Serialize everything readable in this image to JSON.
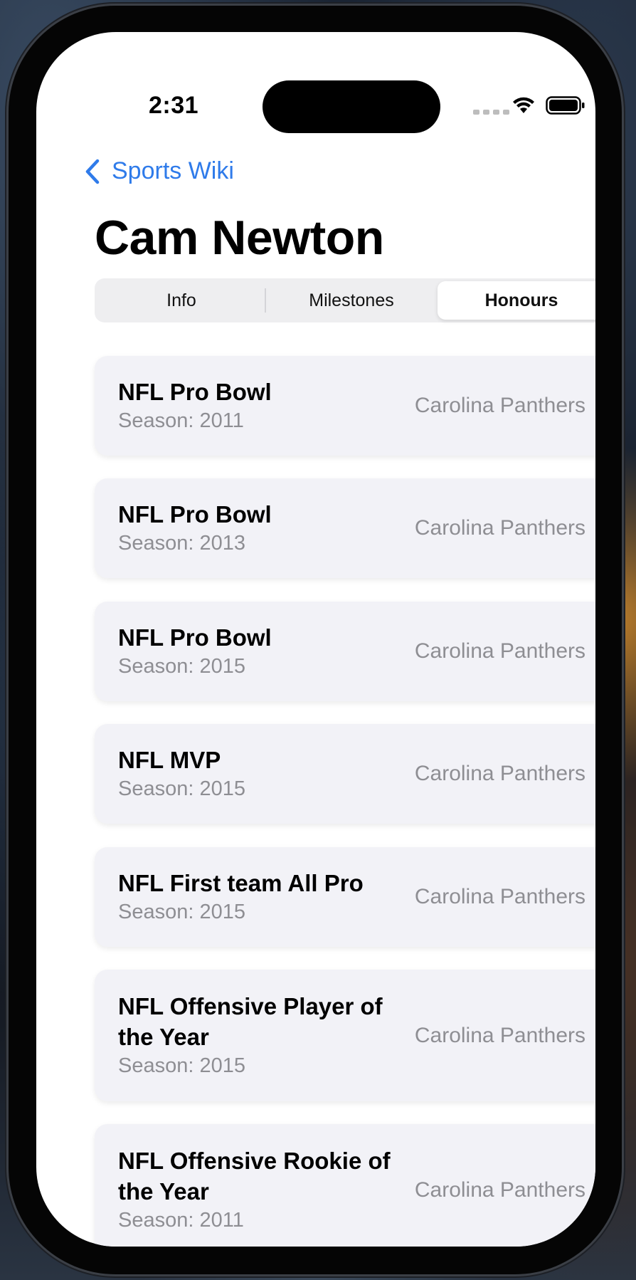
{
  "status_bar": {
    "time": "2:31"
  },
  "nav": {
    "back_label": "Sports Wiki",
    "title": "Cam Newton"
  },
  "tabs": [
    {
      "label": "Info",
      "selected": false
    },
    {
      "label": "Milestones",
      "selected": false
    },
    {
      "label": "Honours",
      "selected": true
    }
  ],
  "honours": [
    {
      "title": "NFL Pro Bowl",
      "season": "Season: 2011",
      "team": "Carolina Panthers"
    },
    {
      "title": "NFL Pro Bowl",
      "season": "Season: 2013",
      "team": "Carolina Panthers"
    },
    {
      "title": "NFL Pro Bowl",
      "season": "Season: 2015",
      "team": "Carolina Panthers"
    },
    {
      "title": "NFL MVP",
      "season": "Season: 2015",
      "team": "Carolina Panthers"
    },
    {
      "title": "NFL First team All Pro",
      "season": "Season: 2015",
      "team": "Carolina Panthers"
    },
    {
      "title": "NFL Offensive Player of the Year",
      "season": "Season: 2015",
      "team": "Carolina Panthers"
    },
    {
      "title": "NFL Offensive Rookie of the Year",
      "season": "Season: 2011",
      "team": "Carolina Panthers"
    }
  ],
  "colors": {
    "accent": "#2f7bea",
    "card_background": "#f2f2f7",
    "secondary_text": "#8e8e93"
  }
}
